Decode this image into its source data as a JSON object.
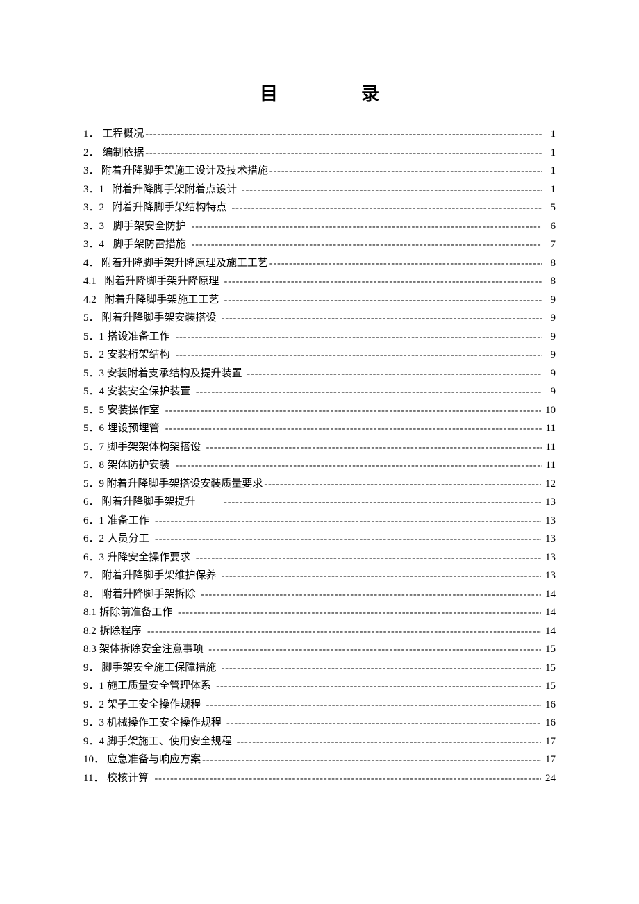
{
  "title": "目录",
  "entries": [
    {
      "num": "1．",
      "label": "工程概况",
      "page": "1",
      "indent": 0
    },
    {
      "num": "2．",
      "label": "编制依据",
      "page": "1",
      "indent": 0
    },
    {
      "num": "3．",
      "label": "附着升降脚手架施工设计及技术措施",
      "page": "1",
      "indent": 0
    },
    {
      "num": "3．1",
      "label": "附着升降脚手架附着点设计",
      "page": "1",
      "indent": 1,
      "gap": true
    },
    {
      "num": "3．2",
      "label": "附着升降脚手架结构特点",
      "page": "5",
      "indent": 1,
      "gap": true
    },
    {
      "num": "3．3",
      "label": "脚手架安全防护",
      "page": "6",
      "indent": 1,
      "gap": true
    },
    {
      "num": "3．4",
      "label": "脚手架防雷措施",
      "page": "7",
      "indent": 1,
      "gap": true
    },
    {
      "num": "4．",
      "label": "附着升降脚手架升降原理及施工工艺",
      "page": "8",
      "indent": 0
    },
    {
      "num": "4.1",
      "label": "附着升降脚手架升降原理",
      "page": "8",
      "indent": 1,
      "gap": true
    },
    {
      "num": "4.2",
      "label": "附着升降脚手架施工工艺",
      "page": "9",
      "indent": 1,
      "gap": true
    },
    {
      "num": "5．",
      "label": "附着升降脚手架安装搭设",
      "page": "9",
      "indent": 0,
      "gap": true
    },
    {
      "num": "5．1",
      "label": "搭设准备工作",
      "page": "9",
      "indent": 0,
      "gap": true
    },
    {
      "num": "5．2",
      "label": "安装桁架结构",
      "page": "9",
      "indent": 0,
      "gap": true
    },
    {
      "num": "5．3",
      "label": "安装附着支承结构及提升装置",
      "page": "9",
      "indent": 0,
      "gap": true
    },
    {
      "num": "5．4",
      "label": "安装安全保护装置",
      "page": "9",
      "indent": 0,
      "gap": true
    },
    {
      "num": "5．5",
      "label": "安装操作室",
      "page": "10",
      "indent": 0,
      "gap": true
    },
    {
      "num": "5．6",
      "label": "埋设预埋管",
      "page": "11",
      "indent": 0,
      "gap": true
    },
    {
      "num": "5．7",
      "label": "脚手架架体构架搭设",
      "page": "11",
      "indent": 0,
      "gap": true
    },
    {
      "num": "5．8",
      "label": "架体防护安装",
      "page": "11",
      "indent": 0,
      "gap": true
    },
    {
      "num": "5．9",
      "label": "附着升降脚手架搭设安装质量要求",
      "page": "12",
      "indent": 0
    },
    {
      "num": "6．",
      "label": "附着升降脚手架提升",
      "page": "13",
      "indent": 0,
      "wide_gap": true
    },
    {
      "num": "6．1",
      "label": "准备工作",
      "page": "13",
      "indent": 0,
      "gap": true
    },
    {
      "num": "6．2",
      "label": "人员分工",
      "page": "13",
      "indent": 0,
      "gap": true
    },
    {
      "num": "6．3",
      "label": "升降安全操作要求",
      "page": "13",
      "indent": 0,
      "gap": true
    },
    {
      "num": "7．",
      "label": "附着升降脚手架维护保养",
      "page": "13",
      "indent": 0,
      "gap": true
    },
    {
      "num": "8．",
      "label": "附着升降脚手架拆除",
      "page": "14",
      "indent": 0,
      "gap": true
    },
    {
      "num": "8.1",
      "label": "拆除前准备工作",
      "page": "14",
      "indent": 0,
      "gap": true
    },
    {
      "num": "8.2",
      "label": "拆除程序",
      "page": "14",
      "indent": 0,
      "gap": true
    },
    {
      "num": "8.3",
      "label": "架体拆除安全注意事项",
      "page": "15",
      "indent": 0,
      "gap": true
    },
    {
      "num": "9．",
      "label": "脚手架安全施工保障措施",
      "page": "15",
      "indent": 0,
      "gap": true
    },
    {
      "num": "9．1",
      "label": "施工质量安全管理体系",
      "page": "15",
      "indent": 0,
      "gap": true
    },
    {
      "num": "9．2",
      "label": "架子工安全操作规程",
      "page": "16",
      "indent": 0,
      "gap": true
    },
    {
      "num": "9．3",
      "label": "机械操作工安全操作规程",
      "page": "16",
      "indent": 0,
      "gap": true
    },
    {
      "num": "9．4",
      "label": "脚手架施工、使用安全规程",
      "page": "17",
      "indent": 0,
      "gap": true
    },
    {
      "num": "10．",
      "label": "应急准备与响应方案",
      "page": "17",
      "indent": 0
    },
    {
      "num": "11．",
      "label": "校核计算",
      "page": "24",
      "indent": 0,
      "gap": true
    }
  ]
}
